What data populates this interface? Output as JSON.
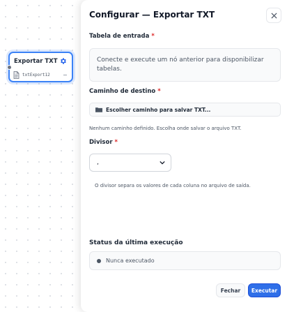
{
  "node": {
    "title": "Exportar TXT",
    "variable": "txtExport12",
    "gear_icon": "gear-icon",
    "file_icon": "file-icon"
  },
  "panel": {
    "title": "Configurar — Exportar TXT",
    "close_icon": "close-icon",
    "input_table": {
      "label": "Tabela de entrada",
      "required_mark": "*",
      "placeholder": "Conecte e execute um nó anterior para disponibilizar tabelas."
    },
    "destination": {
      "label": "Caminho de destino",
      "required_mark": "*",
      "button_label": "Escolher caminho para salvar TXT...",
      "folder_icon": "folder-icon",
      "hint": "Nenhum caminho definido. Escolha onde salvar o arquivo TXT."
    },
    "divider": {
      "label": "Divisor",
      "required_mark": "*",
      "selected": ",",
      "hint": "O divisor separa os valores de cada coluna no arquivo de saída."
    },
    "status": {
      "title": "Status da última execução",
      "text": "Nunca executado"
    },
    "footer": {
      "close_label": "Fechar",
      "run_label": "Executar"
    }
  },
  "colors": {
    "accent": "#2f6fe8",
    "required": "#dc2626",
    "node_border": "#3b82f6"
  }
}
